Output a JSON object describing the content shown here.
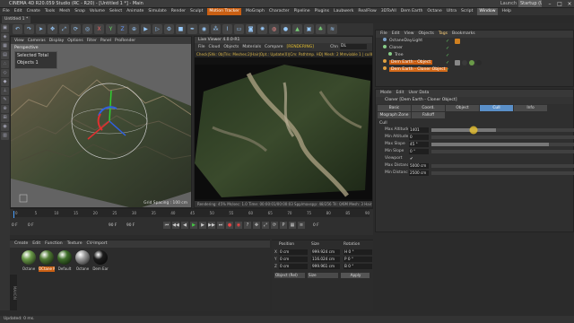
{
  "titlebar": {
    "title": "CINEMA 4D R20.059 Studio (RC - R20) - [Untitled 1 *] - Main",
    "launch": "Launch",
    "layout": "Startup (User)"
  },
  "menubar": {
    "items": [
      "File",
      "Edit",
      "Create",
      "Tools",
      "Mesh",
      "Snap",
      "Volume",
      "Select",
      "Animate",
      "Simulate",
      "Render",
      "Sculpt",
      "Motion Tracker",
      "MoGraph",
      "Character",
      "Pipeline",
      "Plugins",
      "Laubwerk",
      "RealFlow",
      "3DToAll",
      "Dem Earth",
      "Octane",
      "Ultra",
      "Script",
      "Window",
      "Help"
    ],
    "highlight": "Motion Tracker",
    "highlight2": "Window"
  },
  "doctab": "Untitled 1 *",
  "viewport1": {
    "menu": [
      "View",
      "Cameras",
      "Display",
      "Options",
      "Filter",
      "Panel",
      "ProRender"
    ],
    "label": "Perspective",
    "grid": "Grid Spacing : 100 cm",
    "sel_label": "Selected Total",
    "sel_value": "Objects  1"
  },
  "renderview": {
    "title": "Live Viewer 4.0.0-R1",
    "menu": [
      "File",
      "Cloud",
      "Objects",
      "Materials",
      "Compare",
      "[RENDERING]"
    ],
    "channel": "Chn",
    "channel_value": "DL",
    "info": "Check|Shk: 0b|Tris: Meshes:2|Hair|Opt.: Update(0)|Cm: Pathtmp. HD| Mesh: 2 Mmviable 1 | cull&grid",
    "status": "Rendering: 45%  Ms/sec: 1.0  Time: 00:00:01/00:00:03  Spp/maxspp: 48/256  Tri: 0/6M  Mesh: 3  Hair: 0  GPU: 51%"
  },
  "objmgr": {
    "tabs": [
      "File",
      "Edit",
      "View",
      "Objects",
      "Tags",
      "Bookmarks"
    ],
    "rows": [
      {
        "name": "OctaneDayLight",
        "indent": 0,
        "dot": "#7aa0c8"
      },
      {
        "name": "Cloner",
        "indent": 0,
        "dot": "#8c8"
      },
      {
        "name": "Tree",
        "indent": 1,
        "dot": "#8c8"
      },
      {
        "name": "Dem Earth - Object",
        "indent": 0,
        "dot": "#e0a040",
        "sel": true
      },
      {
        "name": "Dem Earth - Cloner Object",
        "indent": 0,
        "dot": "#e0a040",
        "sel2": true
      }
    ]
  },
  "attr": {
    "tabs": [
      "Mode",
      "Edit",
      "User Data"
    ],
    "head": "Cloner [Dem Earth - Cloner Object]",
    "ptabs": [
      "Basic",
      "Coord.",
      "Object",
      "Cull",
      "Info",
      "Mograph Zone",
      "Falloff"
    ],
    "active_ptab": "Cull",
    "section": "Cull",
    "params": [
      {
        "label": "Max Altitude",
        "value": "1401",
        "fill": 0.45
      },
      {
        "label": "Min Altitude",
        "value": "0",
        "fill": 0.0
      },
      {
        "label": "Max Slope",
        "value": "45 °",
        "fill": 0.82
      },
      {
        "label": "Min Slope",
        "value": "0 °",
        "fill": 0.0
      },
      {
        "label": "Viewport",
        "value": "✔",
        "fill": -1
      },
      {
        "label": "Max Distance",
        "value": "5000 cm",
        "fill": 0.0
      },
      {
        "label": "Min Distance",
        "value": "2500 cm",
        "fill": 0.0
      }
    ]
  },
  "timeline": {
    "ticks": [
      "0",
      "5",
      "10",
      "15",
      "20",
      "25",
      "30",
      "35",
      "40",
      "45",
      "50",
      "55",
      "60",
      "65",
      "70",
      "75",
      "80",
      "85",
      "90"
    ],
    "start": "0 F",
    "cur": "0 F",
    "end": "90 F",
    "end2": "90 F",
    "frame": "0 F"
  },
  "matmgr": {
    "tabs": [
      "Create",
      "Edit",
      "Function",
      "Texture",
      "CV-Import"
    ],
    "materials": [
      {
        "name": "Octane",
        "color": "#6a9a48"
      },
      {
        "name": "OCtane M",
        "color": "#4f7a34"
      },
      {
        "name": "Default",
        "color": "#3e6e2a"
      },
      {
        "name": "Octane",
        "color": "#9a9a9a"
      },
      {
        "name": "Dem Ear",
        "color": "#1c1c1c"
      }
    ]
  },
  "coords": {
    "heads": [
      "Position",
      "Size",
      "Rotation"
    ],
    "rows": [
      {
        "axis": "X",
        "pos": "0 cm",
        "size": "999.924 cm",
        "rot": "H  0 °"
      },
      {
        "axis": "Y",
        "pos": "0 cm",
        "size": "116.024 cm",
        "rot": "P  0 °"
      },
      {
        "axis": "Z",
        "pos": "0 cm",
        "size": "999.961 cm",
        "rot": "B  0 °"
      }
    ],
    "mode": "Object (Rel)",
    "sizemode": "Size",
    "apply": "Apply"
  },
  "statusbar": "Updated: 0 ms."
}
